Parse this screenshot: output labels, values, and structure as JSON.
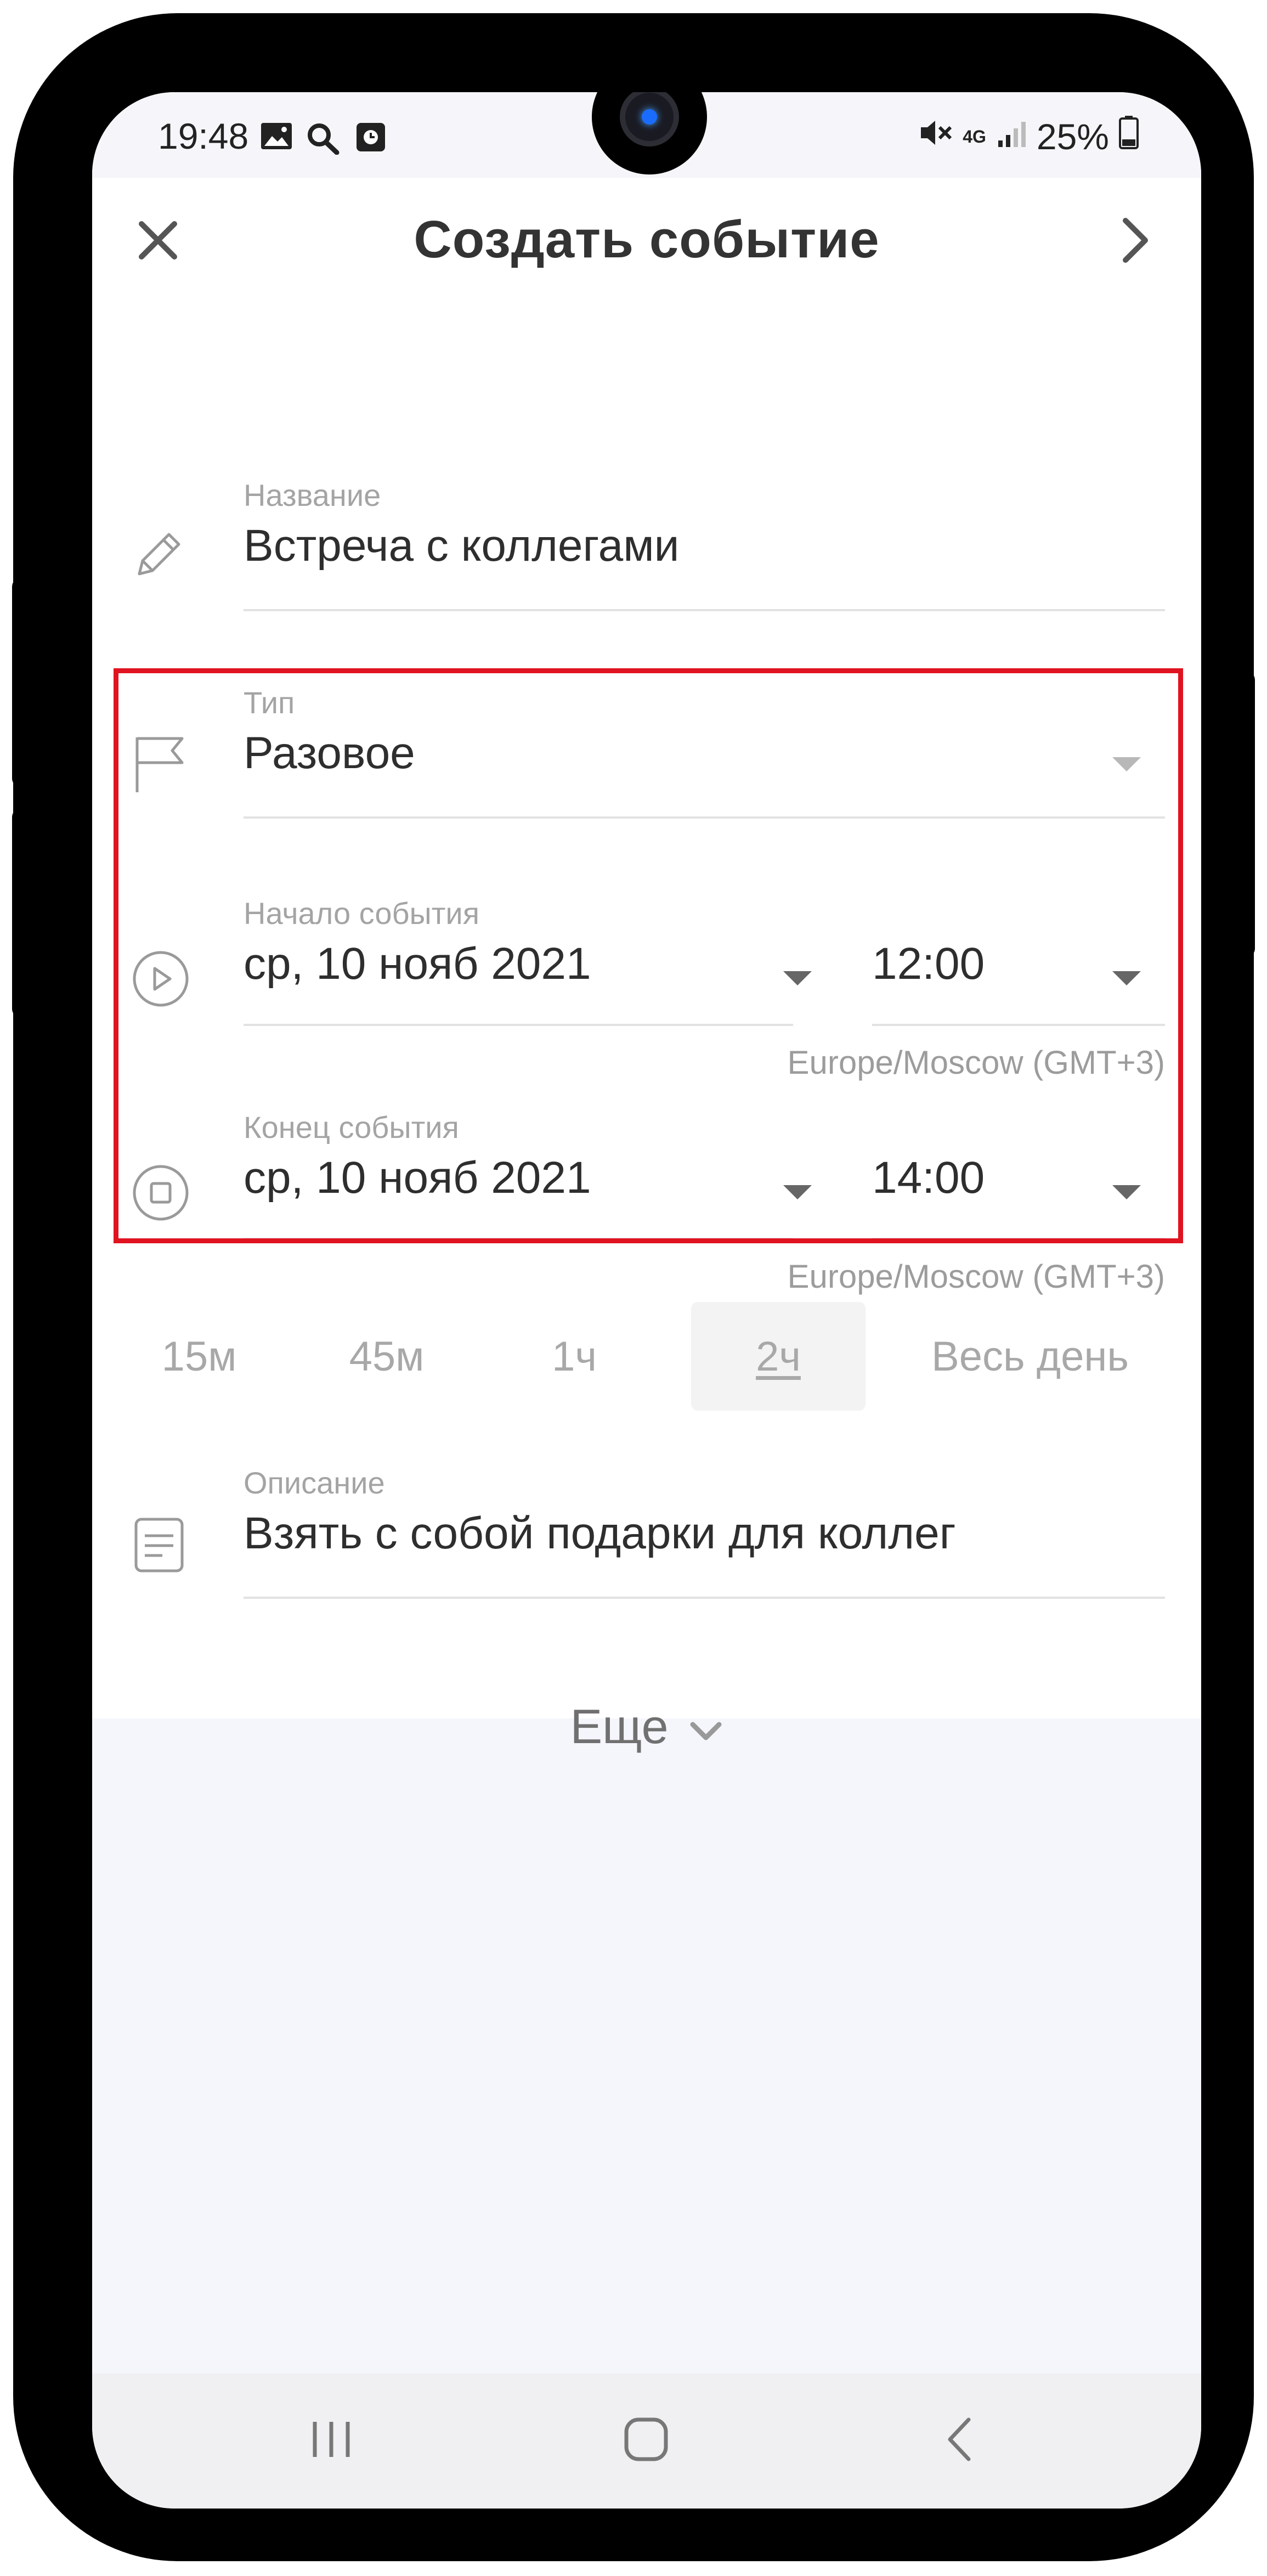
{
  "status_bar": {
    "time": "19:48",
    "network": "4G",
    "battery": "25%",
    "icons": [
      "image-icon",
      "search-icon",
      "alarm-icon",
      "mute-icon",
      "signal-icon",
      "battery-icon"
    ]
  },
  "header": {
    "title": "Создать событие",
    "close_icon": "close-icon",
    "next_icon": "chevron-right-icon"
  },
  "form": {
    "name": {
      "label": "Название",
      "value": "Встреча с коллегами",
      "icon": "pencil-icon"
    },
    "type": {
      "label": "Тип",
      "value": "Разовое",
      "icon": "flag-icon"
    },
    "start": {
      "label": "Начало события",
      "date": "ср, 10 нояб 2021",
      "time": "12:00",
      "timezone": "Europe/Moscow (GMT+3)",
      "icon": "play-circle-icon"
    },
    "end": {
      "label": "Конец события",
      "date": "ср, 10 нояб 2021",
      "time": "14:00",
      "timezone": "Europe/Moscow (GMT+3)",
      "icon": "stop-circle-icon"
    },
    "durations": [
      "15м",
      "45м",
      "1ч",
      "2ч",
      "Весь день"
    ],
    "selected_duration": "2ч",
    "description": {
      "label": "Описание",
      "value": "Взять с собой подарки для коллег",
      "icon": "note-icon"
    }
  },
  "more": {
    "label": "Еще"
  },
  "colors": {
    "highlight": "#e01320",
    "text": "#2e2e2e",
    "muted": "#a4a4a4",
    "background": "#f4f6fc"
  }
}
